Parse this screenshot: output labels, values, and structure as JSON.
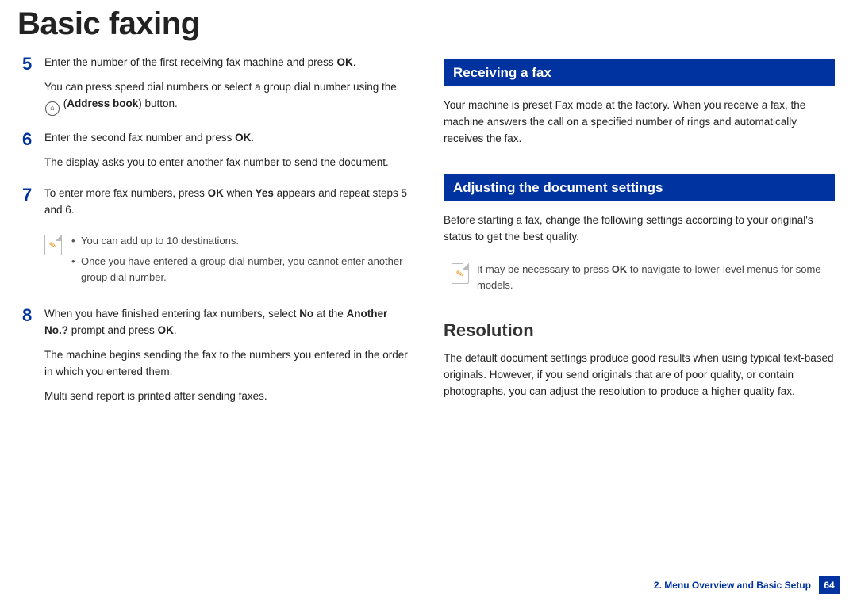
{
  "title": "Basic faxing",
  "left": {
    "steps": [
      {
        "num": "5",
        "paras": [
          {
            "runs": [
              {
                "t": "Enter the number of the first receiving fax machine and press "
              },
              {
                "t": "OK",
                "b": true
              },
              {
                "t": "."
              }
            ]
          },
          {
            "runs": [
              {
                "t": "You can press speed dial numbers or select a group dial number using the "
              },
              {
                "icon": "address-book-icon"
              },
              {
                "t": " ("
              },
              {
                "t": "Address book",
                "b": true
              },
              {
                "t": ") button."
              }
            ]
          }
        ]
      },
      {
        "num": "6",
        "paras": [
          {
            "runs": [
              {
                "t": "Enter the second fax number and press "
              },
              {
                "t": "OK",
                "b": true
              },
              {
                "t": "."
              }
            ]
          },
          {
            "runs": [
              {
                "t": "The display asks you to enter another fax number to send the document."
              }
            ]
          }
        ]
      },
      {
        "num": "7",
        "paras": [
          {
            "runs": [
              {
                "t": "To enter more fax numbers, press "
              },
              {
                "t": "OK",
                "b": true
              },
              {
                "t": " when "
              },
              {
                "t": "Yes",
                "b": true
              },
              {
                "t": " appears and repeat steps 5 and 6."
              }
            ]
          }
        ]
      }
    ],
    "note": [
      "You can add up to 10 destinations.",
      "Once you have entered a group dial number, you cannot enter another group dial number."
    ],
    "step8": {
      "num": "8",
      "paras": [
        {
          "runs": [
            {
              "t": "When you have finished entering fax numbers, select "
            },
            {
              "t": "No",
              "b": true
            },
            {
              "t": " at the "
            },
            {
              "t": "Another No.?",
              "b": true
            },
            {
              "t": " prompt and press "
            },
            {
              "t": "OK",
              "b": true
            },
            {
              "t": "."
            }
          ]
        },
        {
          "runs": [
            {
              "t": "The machine begins sending the fax to the numbers you entered in the order in which you entered them."
            }
          ]
        },
        {
          "runs": [
            {
              "t": "Multi send report is printed after sending faxes."
            }
          ]
        }
      ]
    }
  },
  "right": {
    "section1_title": "Receiving a fax",
    "section1_body": "Your machine is preset Fax mode at the factory. When you receive a fax, the machine answers the call on a specified number of rings and automatically receives the fax.",
    "section2_title": "Adjusting the document settings",
    "section2_body": "Before starting a fax, change the following settings according to your original's status to get the best quality.",
    "note2": {
      "runs": [
        {
          "t": "It may be necessary to press "
        },
        {
          "t": "OK",
          "b": true
        },
        {
          "t": " to navigate to lower-level menus for some models."
        }
      ]
    },
    "sub_heading": "Resolution",
    "sub_body": "The default document settings produce good results when using typical text-based originals. However, if you send originals that are of poor quality, or contain photographs, you can adjust the resolution to produce a higher quality fax."
  },
  "footer": {
    "label": "2. Menu Overview and Basic Setup",
    "page": "64"
  }
}
